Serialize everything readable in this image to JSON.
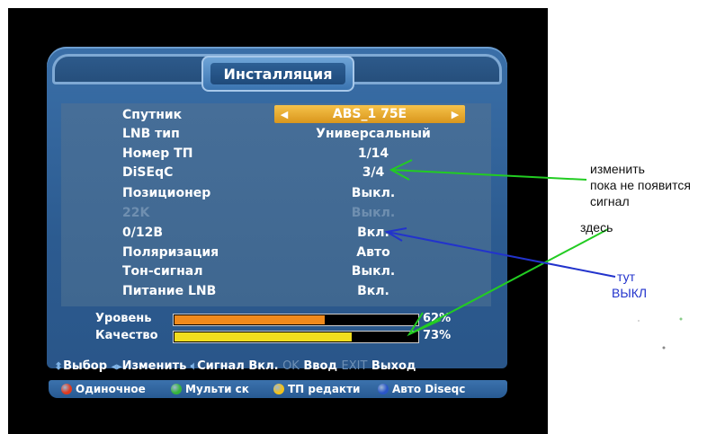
{
  "header": {
    "title": "Инсталляция"
  },
  "satellite": {
    "label": "Спутник",
    "value": "ABS_1 75E"
  },
  "rows": [
    {
      "label": "LNB тип",
      "value": "Универсальный"
    },
    {
      "label": "Номер ТП",
      "value": "1/14"
    },
    {
      "label": "DiSEqC",
      "value": "3/4"
    },
    {
      "label": "Позиционер",
      "value": "Выкл."
    },
    {
      "label": "22K",
      "value": "Выкл."
    },
    {
      "label": "0/12В",
      "value": "Вкл."
    },
    {
      "label": "Поляризация",
      "value": "Авто"
    },
    {
      "label": "Тон-сигнал",
      "value": "Выкл."
    },
    {
      "label": "Питание LNB",
      "value": "Вкл."
    }
  ],
  "signal": {
    "level": {
      "label": "Уровень",
      "percent_text": "62%",
      "percent": 62,
      "color": "#f08a1c"
    },
    "quality": {
      "label": "Качество",
      "percent_text": "73%",
      "percent": 73,
      "color": "#f2dd1e"
    }
  },
  "hints": {
    "select": "Выбор",
    "change": "Изменить",
    "signal": "Сигнал",
    "on": "Вкл.",
    "ok_key": "OK",
    "enter": "Ввод",
    "exit_key": "EXIT",
    "exit": "Выход"
  },
  "keys": [
    {
      "label": "Одиночное",
      "color": "#e03a1e"
    },
    {
      "label": "Мульти ск",
      "color": "#36b43a"
    },
    {
      "label": "ТП редакти",
      "color": "#f2c21a"
    },
    {
      "label": "Авто",
      "color": "#2a56c8"
    }
  ],
  "keys_suffix": "Diseqc",
  "annotations": {
    "green_note_line1": "изменить",
    "green_note_line2": "пока не появится",
    "green_note_line3": "сигнал",
    "green_note_here": "здесь",
    "blue_note_line1": "тут",
    "blue_note_line2": "ВЫКЛ",
    "green_color": "#22cc22",
    "blue_color": "#2233cc"
  }
}
